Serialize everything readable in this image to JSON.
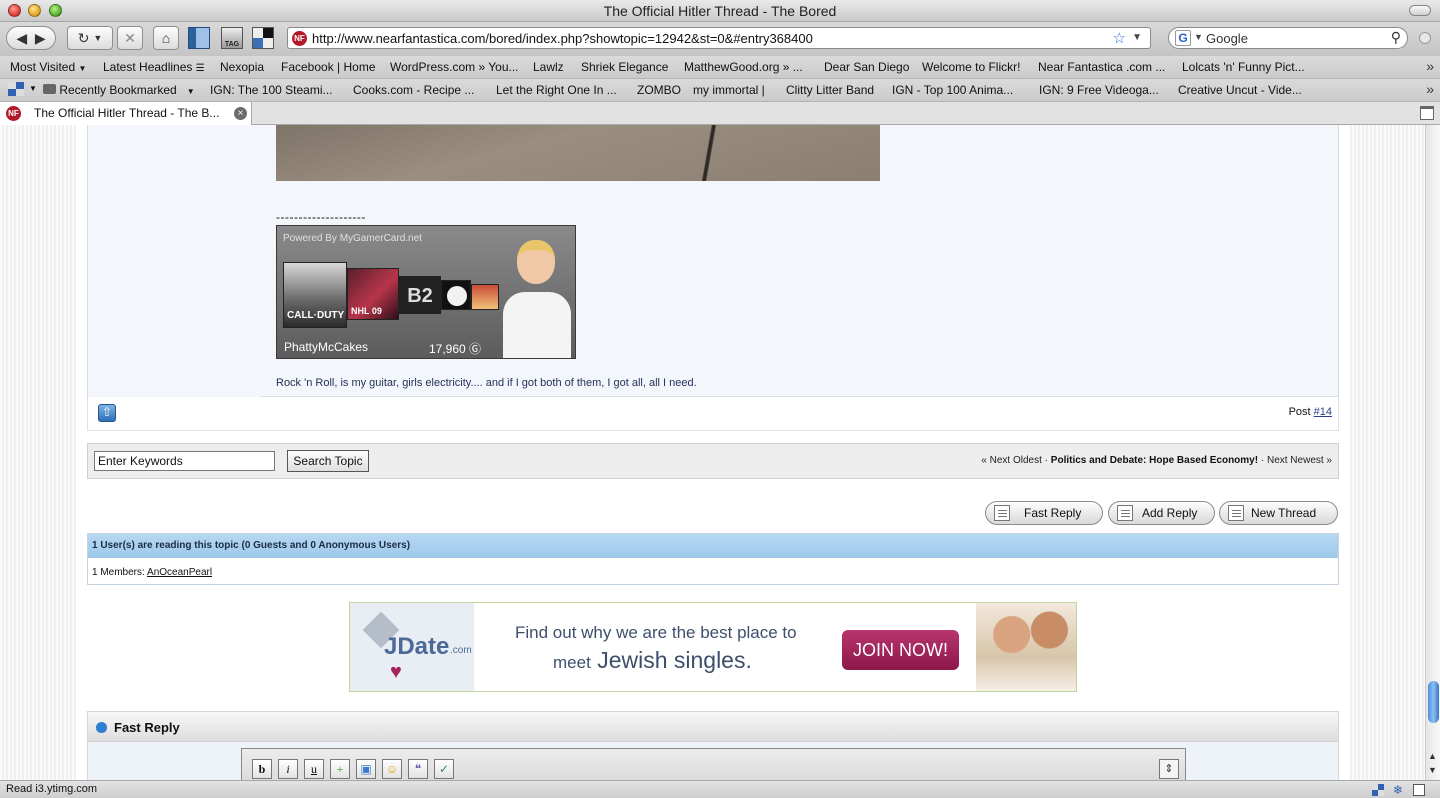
{
  "window": {
    "title": "The Official Hitler Thread - The Bored"
  },
  "toolbar": {
    "url": "http://www.nearfantastica.com/bored/index.php?showtopic=12942&st=0&#entry368400",
    "search_engine": "Google",
    "icons": [
      "back-icon",
      "forward-icon",
      "reload-icon",
      "stop-icon",
      "home-icon",
      "bookmark-icon",
      "tag-icon",
      "delicious-icon",
      "star-icon",
      "search-icon"
    ],
    "tag_label": "TAG"
  },
  "bookmarks": {
    "row1": [
      "Most Visited",
      "Latest Headlines",
      "Nexopia",
      "Facebook | Home",
      "WordPress.com » You...",
      "Lawlz",
      "Shriek Elegance",
      "MatthewGood.org » ...",
      "Dear San Diego",
      "Welcome to Flickr!",
      "Near Fantastica .com ...",
      "Lolcats 'n' Funny Pict..."
    ],
    "row2": [
      "Recently Bookmarked",
      "IGN: The 100 Steami...",
      "Cooks.com - Recipe ...",
      "Let the Right One In ...",
      "ZOMBO",
      "my immortal |",
      "Clitty Litter Band",
      "IGN - Top 100 Anima...",
      "IGN: 9 Free Videoga...",
      "Creative Uncut - Vide..."
    ]
  },
  "tab": {
    "label": "The Official Hitler Thread - The B..."
  },
  "post": {
    "separator": "--------------------",
    "gamercard": {
      "powered_by": "Powered By MyGamerCard.net",
      "gamertag": "PhattyMcCakes",
      "score": "17,960",
      "game_tiles": [
        "CALL·DUTY",
        "NHL 09",
        "B2"
      ]
    },
    "signature_quote": "Rock 'n Roll, is my guitar, girls electricity.... and if I got both of them, I got all, all I need.",
    "post_label": "Post",
    "post_number": "#14"
  },
  "search": {
    "keyword_value": "Enter Keywords",
    "button_label": "Search Topic",
    "nav_prev": "« Next Oldest",
    "nav_separator": "·",
    "nav_topic": "Politics and Debate: Hope Based Economy!",
    "nav_next": "Next Newest »"
  },
  "actions": {
    "fast_reply": "Fast Reply",
    "add_reply": "Add Reply",
    "new_thread": "New Thread"
  },
  "readers": {
    "header": "1 User(s) are reading this topic (0 Guests and 0 Anonymous Users)",
    "members_label": "1 Members:",
    "member": "AnOceanPearl"
  },
  "ad": {
    "brand": "JDate",
    "brand_suffix": ".com",
    "line1": "Find out why we are the best place to",
    "line2_prefix": "meet",
    "line2_emph": "Jewish singles.",
    "cta": "JOIN NOW!"
  },
  "fast_reply": {
    "title": "Fast Reply",
    "editor_buttons": [
      "b",
      "i",
      "u"
    ]
  },
  "status": {
    "text": "Read i3.ytimg.com"
  }
}
